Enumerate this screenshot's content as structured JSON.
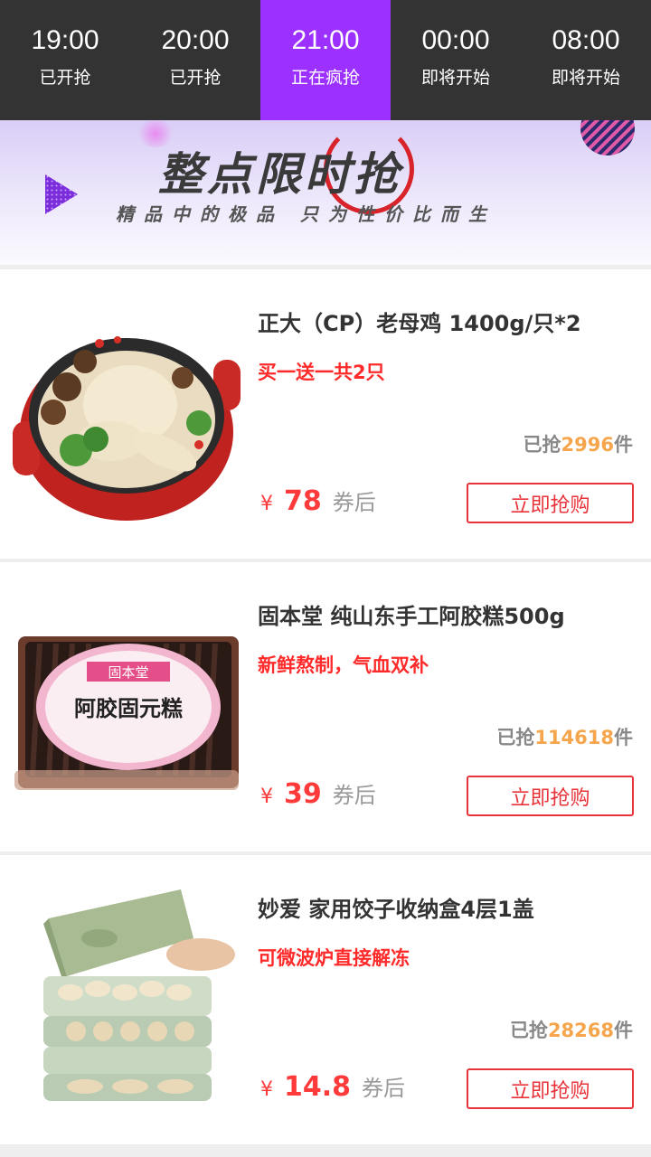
{
  "time_tabs": [
    {
      "time": "19:00",
      "status": "已开抢"
    },
    {
      "time": "20:00",
      "status": "已开抢"
    },
    {
      "time": "21:00",
      "status": "正在疯抢"
    },
    {
      "time": "00:00",
      "status": "即将开始"
    },
    {
      "time": "08:00",
      "status": "即将开始"
    }
  ],
  "active_tab_color": "#9b30ff",
  "banner": {
    "title": "整点限时抢",
    "subtitle": "精品中的极品 只为性价比而生"
  },
  "products": [
    {
      "name": "正大（CP）老母鸡 1400g/只*2",
      "tag": "买一送一共2只",
      "sold_prefix": "已抢",
      "sold_count": "2996",
      "sold_suffix": "件",
      "currency": "¥",
      "price": "78",
      "price_note": "券后",
      "buy_label": "立即抢购",
      "image_icon": "chicken-pot-image"
    },
    {
      "name": "固本堂 纯山东手工阿胶糕500g",
      "tag": "新鲜熬制，气血双补",
      "sold_prefix": "已抢",
      "sold_count": "114618",
      "sold_suffix": "件",
      "currency": "¥",
      "price": "39",
      "price_note": "券后",
      "buy_label": "立即抢购",
      "image_icon": "ejiao-box-image",
      "image_brand": "固本堂",
      "image_label": "阿胶固元糕"
    },
    {
      "name": "妙爱 家用饺子收纳盒4层1盖",
      "tag": "可微波炉直接解冻",
      "sold_prefix": "已抢",
      "sold_count": "28268",
      "sold_suffix": "件",
      "currency": "¥",
      "price": "14.8",
      "price_note": "券后",
      "buy_label": "立即抢购",
      "image_icon": "dumpling-box-image"
    }
  ]
}
